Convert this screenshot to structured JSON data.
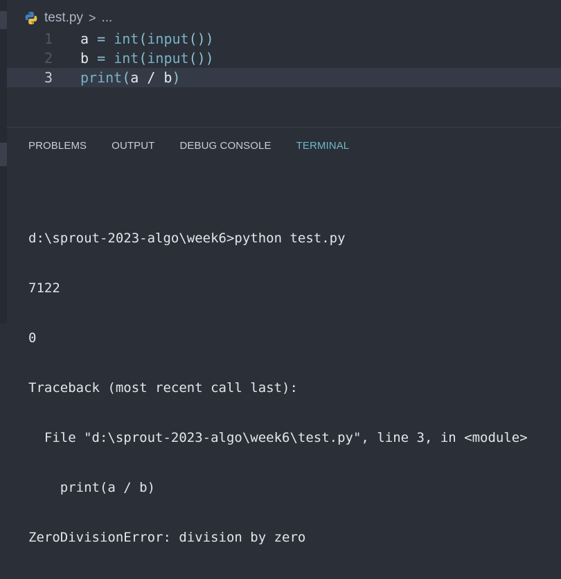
{
  "breadcrumb": {
    "file": "test.py",
    "separator": ">",
    "more": "..."
  },
  "editor": {
    "lines": [
      {
        "num": "1",
        "var": "a",
        "op": "=",
        "fn1": "int",
        "fn2": "input",
        "close": "())"
      },
      {
        "num": "2",
        "var": "b",
        "op": "=",
        "fn1": "int",
        "fn2": "input",
        "close": "())"
      },
      {
        "num": "3",
        "fn": "print",
        "args": "a / b"
      }
    ]
  },
  "panel": {
    "tabs": [
      "PROBLEMS",
      "OUTPUT",
      "DEBUG CONSOLE",
      "TERMINAL"
    ],
    "active_tab": "TERMINAL"
  },
  "terminal": {
    "lines": [
      "d:\\sprout-2023-algo\\week6>python test.py",
      "7122",
      "0",
      "Traceback (most recent call last):",
      "  File \"d:\\sprout-2023-algo\\week6\\test.py\", line 3, in <module>",
      "    print(a / b)",
      "ZeroDivisionError: division by zero"
    ]
  },
  "colors": {
    "background": "#2a2f38",
    "accent_tab": "#6fb7c9",
    "function": "#7ab3c6"
  }
}
